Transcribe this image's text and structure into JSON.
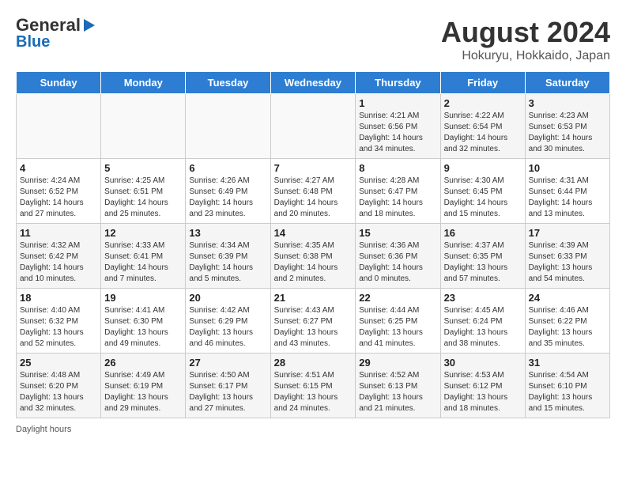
{
  "header": {
    "logo_line1": "General",
    "logo_line2": "Blue",
    "title": "August 2024",
    "subtitle": "Hokuryu, Hokkaido, Japan"
  },
  "calendar": {
    "days_of_week": [
      "Sunday",
      "Monday",
      "Tuesday",
      "Wednesday",
      "Thursday",
      "Friday",
      "Saturday"
    ],
    "weeks": [
      [
        {
          "day": "",
          "info": ""
        },
        {
          "day": "",
          "info": ""
        },
        {
          "day": "",
          "info": ""
        },
        {
          "day": "",
          "info": ""
        },
        {
          "day": "1",
          "info": "Sunrise: 4:21 AM\nSunset: 6:56 PM\nDaylight: 14 hours and 34 minutes."
        },
        {
          "day": "2",
          "info": "Sunrise: 4:22 AM\nSunset: 6:54 PM\nDaylight: 14 hours and 32 minutes."
        },
        {
          "day": "3",
          "info": "Sunrise: 4:23 AM\nSunset: 6:53 PM\nDaylight: 14 hours and 30 minutes."
        }
      ],
      [
        {
          "day": "4",
          "info": "Sunrise: 4:24 AM\nSunset: 6:52 PM\nDaylight: 14 hours and 27 minutes."
        },
        {
          "day": "5",
          "info": "Sunrise: 4:25 AM\nSunset: 6:51 PM\nDaylight: 14 hours and 25 minutes."
        },
        {
          "day": "6",
          "info": "Sunrise: 4:26 AM\nSunset: 6:49 PM\nDaylight: 14 hours and 23 minutes."
        },
        {
          "day": "7",
          "info": "Sunrise: 4:27 AM\nSunset: 6:48 PM\nDaylight: 14 hours and 20 minutes."
        },
        {
          "day": "8",
          "info": "Sunrise: 4:28 AM\nSunset: 6:47 PM\nDaylight: 14 hours and 18 minutes."
        },
        {
          "day": "9",
          "info": "Sunrise: 4:30 AM\nSunset: 6:45 PM\nDaylight: 14 hours and 15 minutes."
        },
        {
          "day": "10",
          "info": "Sunrise: 4:31 AM\nSunset: 6:44 PM\nDaylight: 14 hours and 13 minutes."
        }
      ],
      [
        {
          "day": "11",
          "info": "Sunrise: 4:32 AM\nSunset: 6:42 PM\nDaylight: 14 hours and 10 minutes."
        },
        {
          "day": "12",
          "info": "Sunrise: 4:33 AM\nSunset: 6:41 PM\nDaylight: 14 hours and 7 minutes."
        },
        {
          "day": "13",
          "info": "Sunrise: 4:34 AM\nSunset: 6:39 PM\nDaylight: 14 hours and 5 minutes."
        },
        {
          "day": "14",
          "info": "Sunrise: 4:35 AM\nSunset: 6:38 PM\nDaylight: 14 hours and 2 minutes."
        },
        {
          "day": "15",
          "info": "Sunrise: 4:36 AM\nSunset: 6:36 PM\nDaylight: 14 hours and 0 minutes."
        },
        {
          "day": "16",
          "info": "Sunrise: 4:37 AM\nSunset: 6:35 PM\nDaylight: 13 hours and 57 minutes."
        },
        {
          "day": "17",
          "info": "Sunrise: 4:39 AM\nSunset: 6:33 PM\nDaylight: 13 hours and 54 minutes."
        }
      ],
      [
        {
          "day": "18",
          "info": "Sunrise: 4:40 AM\nSunset: 6:32 PM\nDaylight: 13 hours and 52 minutes."
        },
        {
          "day": "19",
          "info": "Sunrise: 4:41 AM\nSunset: 6:30 PM\nDaylight: 13 hours and 49 minutes."
        },
        {
          "day": "20",
          "info": "Sunrise: 4:42 AM\nSunset: 6:29 PM\nDaylight: 13 hours and 46 minutes."
        },
        {
          "day": "21",
          "info": "Sunrise: 4:43 AM\nSunset: 6:27 PM\nDaylight: 13 hours and 43 minutes."
        },
        {
          "day": "22",
          "info": "Sunrise: 4:44 AM\nSunset: 6:25 PM\nDaylight: 13 hours and 41 minutes."
        },
        {
          "day": "23",
          "info": "Sunrise: 4:45 AM\nSunset: 6:24 PM\nDaylight: 13 hours and 38 minutes."
        },
        {
          "day": "24",
          "info": "Sunrise: 4:46 AM\nSunset: 6:22 PM\nDaylight: 13 hours and 35 minutes."
        }
      ],
      [
        {
          "day": "25",
          "info": "Sunrise: 4:48 AM\nSunset: 6:20 PM\nDaylight: 13 hours and 32 minutes."
        },
        {
          "day": "26",
          "info": "Sunrise: 4:49 AM\nSunset: 6:19 PM\nDaylight: 13 hours and 29 minutes."
        },
        {
          "day": "27",
          "info": "Sunrise: 4:50 AM\nSunset: 6:17 PM\nDaylight: 13 hours and 27 minutes."
        },
        {
          "day": "28",
          "info": "Sunrise: 4:51 AM\nSunset: 6:15 PM\nDaylight: 13 hours and 24 minutes."
        },
        {
          "day": "29",
          "info": "Sunrise: 4:52 AM\nSunset: 6:13 PM\nDaylight: 13 hours and 21 minutes."
        },
        {
          "day": "30",
          "info": "Sunrise: 4:53 AM\nSunset: 6:12 PM\nDaylight: 13 hours and 18 minutes."
        },
        {
          "day": "31",
          "info": "Sunrise: 4:54 AM\nSunset: 6:10 PM\nDaylight: 13 hours and 15 minutes."
        }
      ]
    ]
  },
  "footer": {
    "note": "Daylight hours"
  }
}
